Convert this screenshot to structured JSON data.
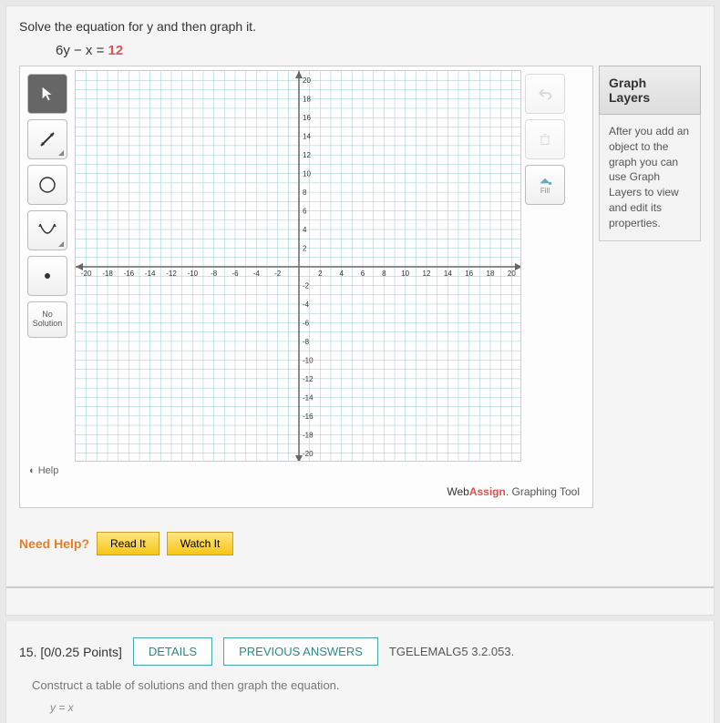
{
  "question": {
    "prompt": "Solve the equation for y and then graph it.",
    "equation_lhs": "6y − x = ",
    "equation_rhs": "12"
  },
  "tools": {
    "pointer": "pointer",
    "line": "line",
    "circle": "circle",
    "parabola": "parabola",
    "point": "point",
    "no_solution_l1": "No",
    "no_solution_l2": "Solution"
  },
  "right_tools": {
    "fill": "Fill"
  },
  "help_link": "Help",
  "brand": {
    "pre": "Web",
    "mid": "Assign",
    "suffix": ". Graphing Tool"
  },
  "layers": {
    "title": "Graph Layers",
    "body": "After you add an object to the graph you can use Graph Layers to view and edit its properties."
  },
  "need_help": {
    "label": "Need Help?",
    "read": "Read It",
    "watch": "Watch It"
  },
  "next_q": {
    "number": "15.",
    "points": "[0/0.25 Points]",
    "details": "DETAILS",
    "previous": "PREVIOUS ANSWERS",
    "ref": "TGELEMALG5 3.2.053.",
    "sub": "Construct a table of solutions and then graph the equation.",
    "eq": "y = x"
  },
  "chart_data": {
    "type": "scatter",
    "title": "",
    "xlabel": "",
    "ylabel": "",
    "xlim": [
      -21,
      21
    ],
    "ylim": [
      -21,
      21
    ],
    "xticks": [
      -20,
      -18,
      -16,
      -14,
      -12,
      -10,
      -8,
      -6,
      -4,
      -2,
      2,
      4,
      6,
      8,
      10,
      12,
      14,
      16,
      18,
      20
    ],
    "yticks": [
      -20,
      -18,
      -16,
      -14,
      -12,
      -10,
      -8,
      -6,
      -4,
      -2,
      2,
      4,
      6,
      8,
      10,
      12,
      14,
      16,
      18,
      20
    ],
    "grid": true,
    "series": []
  }
}
